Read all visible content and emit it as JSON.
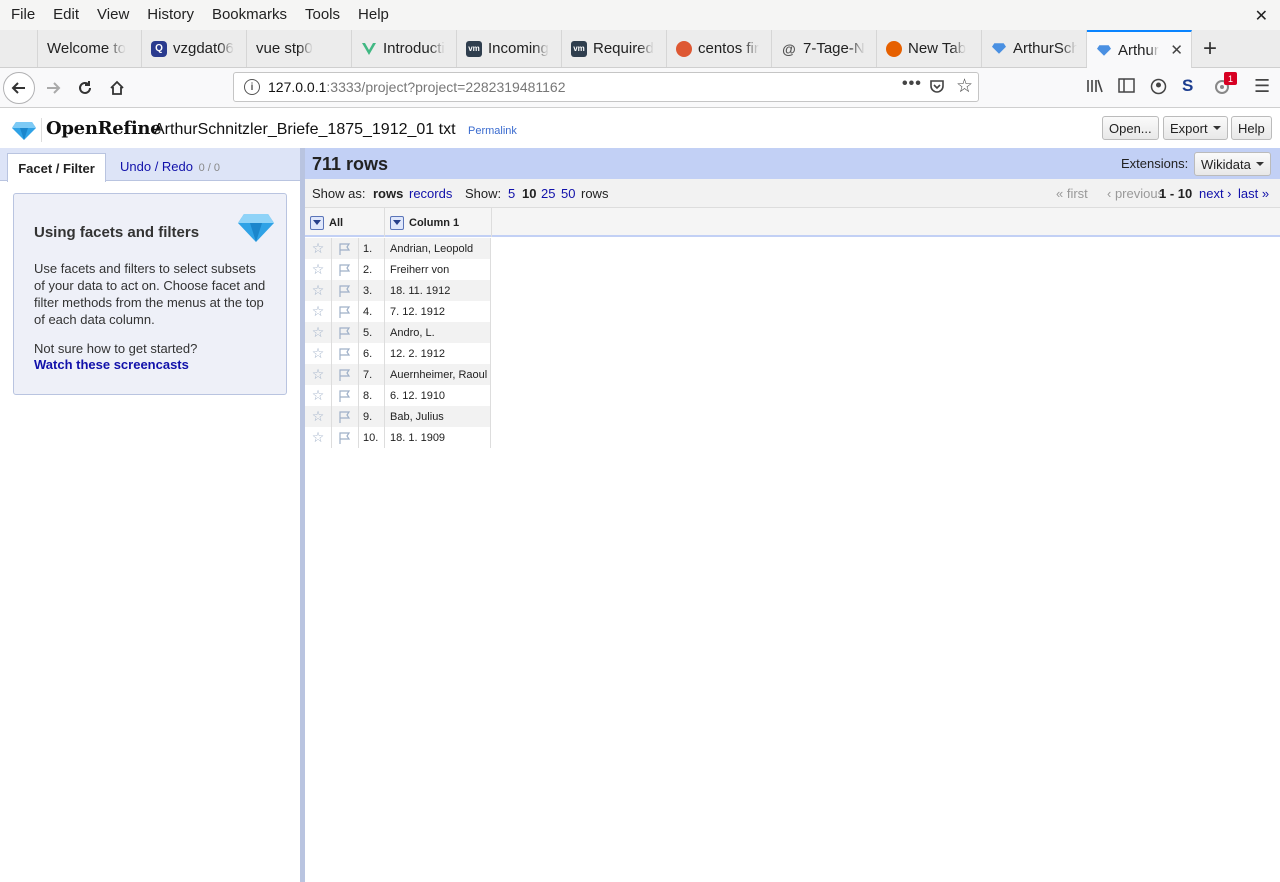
{
  "browser": {
    "menu": [
      "File",
      "Edit",
      "View",
      "History",
      "Bookmarks",
      "Tools",
      "Help"
    ],
    "tabs": [
      {
        "label": "Welcome to",
        "favicon": "none",
        "color": ""
      },
      {
        "label": "vzgdat06",
        "favicon": "qnap-icon",
        "color": "#2a3b8f"
      },
      {
        "label": "vue stp0",
        "favicon": "none",
        "color": ""
      },
      {
        "label": "Introducti",
        "favicon": "vue-icon",
        "color": "#41b883"
      },
      {
        "label": "Incoming",
        "favicon": "vm-icon",
        "color": "#2f3e4e"
      },
      {
        "label": "Required",
        "favicon": "vm-icon",
        "color": "#2f3e4e"
      },
      {
        "label": "centos fir",
        "favicon": "duckduckgo-icon",
        "color": "#de5833"
      },
      {
        "label": "7-Tage-N",
        "favicon": "at-icon",
        "color": "#555555"
      },
      {
        "label": "New Tab",
        "favicon": "firefox-icon",
        "color": "#e66000"
      },
      {
        "label": "ArthurSch",
        "favicon": "openrefine-icon",
        "color": "#4a90e2"
      },
      {
        "label": "Arthur",
        "favicon": "openrefine-icon",
        "color": "#4a90e2",
        "active": true
      }
    ],
    "url": {
      "host": "127.0.0.1",
      "rest": ":3333/project?project=2282319481162"
    },
    "notification_badge": "1"
  },
  "openrefine": {
    "logo": "OpenRefine",
    "project_name": "ArthurSchnitzler_Briefe_1875_1912_01 txt",
    "permalink": "Permalink",
    "buttons": {
      "open": "Open...",
      "export": "Export",
      "help": "Help"
    },
    "left": {
      "tab_facet": "Facet / Filter",
      "tab_undo": "Undo / Redo",
      "undo_count": "0 / 0",
      "help_title": "Using facets and filters",
      "help_text": "Use facets and filters to select subsets of your data to act on. Choose facet and filter methods from the menus at the top of each data column.",
      "help_question": "Not sure how to get started?",
      "help_link": "Watch these screencasts"
    },
    "summary": {
      "row_count": "711 rows",
      "extensions_label": "Extensions:",
      "extension": "Wikidata"
    },
    "browse": {
      "show_as": "Show as:",
      "rows": "rows",
      "records": "records",
      "show": "Show:",
      "sizes": [
        "5",
        "10",
        "25",
        "50"
      ],
      "rows_suffix": "rows",
      "first": "« first",
      "previous": "‹ previous",
      "range": "1 - 10",
      "next": "next ›",
      "last": "last »"
    },
    "columns": {
      "all": "All",
      "col1": "Column 1"
    },
    "rows": [
      {
        "idx": "1.",
        "value": "Andrian, Leopold"
      },
      {
        "idx": "2.",
        "value": "Freiherr von"
      },
      {
        "idx": "3.",
        "value": "18. 11. 1912"
      },
      {
        "idx": "4.",
        "value": "7. 12. 1912"
      },
      {
        "idx": "5.",
        "value": "Andro, L."
      },
      {
        "idx": "6.",
        "value": "12. 2. 1912"
      },
      {
        "idx": "7.",
        "value": "Auernheimer, Raoul"
      },
      {
        "idx": "8.",
        "value": "6. 12. 1910"
      },
      {
        "idx": "9.",
        "value": "Bab, Julius"
      },
      {
        "idx": "10.",
        "value": "18. 1. 1909"
      }
    ]
  }
}
